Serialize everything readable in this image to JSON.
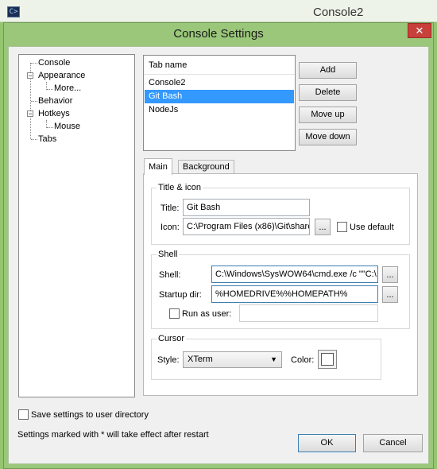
{
  "app": {
    "window_title": "Console2",
    "icon": "console-app-icon"
  },
  "dialog": {
    "title": "Console Settings",
    "close_glyph": "✕"
  },
  "tree": {
    "items": [
      {
        "label": "Console"
      },
      {
        "label": "Appearance",
        "expander": "−"
      },
      {
        "label": "More..."
      },
      {
        "label": "Behavior"
      },
      {
        "label": "Hotkeys",
        "expander": "−"
      },
      {
        "label": "Mouse"
      },
      {
        "label": "Tabs"
      }
    ]
  },
  "tablist": {
    "header": "Tab name",
    "rows": [
      "Console2",
      "Git Bash",
      "NodeJs"
    ],
    "selected_index": 1
  },
  "tab_buttons": {
    "add": "Add",
    "delete": "Delete",
    "move_up": "Move up",
    "move_down": "Move down"
  },
  "panel_tabs": [
    "Main",
    "Background"
  ],
  "title_icon": {
    "group_label": "Title & icon",
    "title_label": "Title:",
    "title_value": "Git Bash",
    "icon_label": "Icon:",
    "icon_value": "C:\\Program Files (x86)\\Git\\share",
    "browse": "...",
    "use_default_label": "Use default"
  },
  "shell": {
    "group_label": "Shell",
    "shell_label": "Shell:",
    "shell_value": "C:\\Windows\\SysWOW64\\cmd.exe /c \"\"C:\\",
    "startup_label": "Startup dir:",
    "startup_value": "%HOMEDRIVE%%HOMEPATH%",
    "browse": "...",
    "run_as_user_label": "Run as user:",
    "run_as_user_value": ""
  },
  "cursor": {
    "group_label": "Cursor",
    "style_label": "Style:",
    "style_value": "XTerm",
    "color_label": "Color:",
    "color_value": "#ffffff"
  },
  "footer": {
    "save_settings_label": "Save settings to user directory",
    "note": "Settings marked with * will take effect after restart",
    "ok": "OK",
    "cancel": "Cancel"
  },
  "colors": {
    "accent": "#3399ff",
    "frame": "#9ac779",
    "close": "#c7403a"
  }
}
